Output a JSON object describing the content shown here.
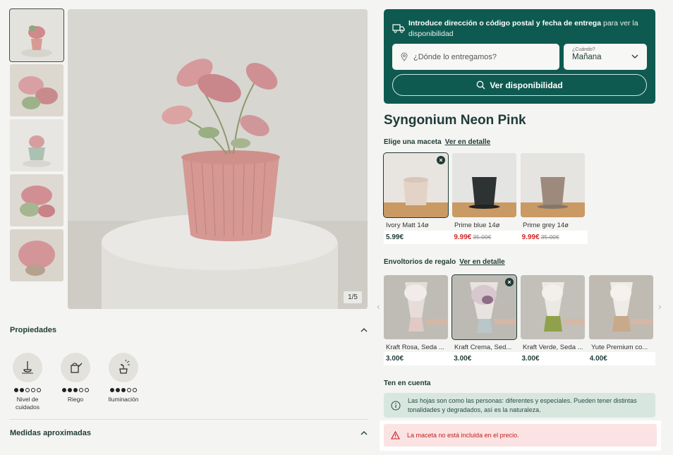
{
  "gallery": {
    "counter": "1/5",
    "thumbnails": [
      "thumb-1",
      "thumb-2",
      "thumb-3",
      "thumb-4",
      "thumb-5"
    ]
  },
  "delivery": {
    "intro_bold": "Introduce dirección o código postal y fecha de entrega",
    "intro_rest": " para ver la disponibilidad",
    "address_placeholder": "¿Dónde lo entregamos?",
    "when_label": "¿Cuándo?",
    "when_value": "Mañana",
    "check_button": "Ver disponibilidad"
  },
  "product": {
    "title": "Syngonium Neon Pink"
  },
  "pots": {
    "heading": "Elige una maceta",
    "link": "Ver en detalle",
    "items": [
      {
        "name": "Ivory Matt 14ø",
        "price": "5.99€",
        "old_price": "",
        "selected": true
      },
      {
        "name": "Prime blue 14ø",
        "price": "9.99€",
        "old_price": "35.00€",
        "selected": false
      },
      {
        "name": "Prime grey 14ø",
        "price": "9.99€",
        "old_price": "35.00€",
        "selected": false
      }
    ]
  },
  "wraps": {
    "heading": "Envoltorios de regalo",
    "link": "Ver en detalle",
    "items": [
      {
        "name": "Kraft Rosa, Seda ...",
        "price": "3.00€"
      },
      {
        "name": "Kraft Crema, Sed...",
        "price": "3.00€"
      },
      {
        "name": "Kraft Verde, Seda ...",
        "price": "3.00€"
      },
      {
        "name": "Yute Premium co...",
        "price": "4.00€"
      }
    ]
  },
  "properties": {
    "heading": "Propiedades",
    "items": [
      {
        "label": "Nivel de cuidados",
        "level": 2,
        "max": 5,
        "icon": "shovel-icon"
      },
      {
        "label": "Riego",
        "level": 3,
        "max": 5,
        "icon": "watering-can-icon"
      },
      {
        "label": "Iluminación",
        "level": 3,
        "max": 5,
        "icon": "sun-plant-icon"
      }
    ]
  },
  "measures": {
    "heading": "Medidas aproximadas"
  },
  "notes": {
    "heading": "Ten en cuenta",
    "info": "Las hojas son como las personas: diferentes y especiales. Pueden tener distintas tonalidades y degradados, así es la naturaleza.",
    "warning": "La maceta no está incluida en el precio."
  },
  "colors": {
    "brand": "#0e5a50",
    "sale": "#d12828",
    "warning_bg": "#fbe3e3",
    "info_bg": "#d7e7e0"
  }
}
